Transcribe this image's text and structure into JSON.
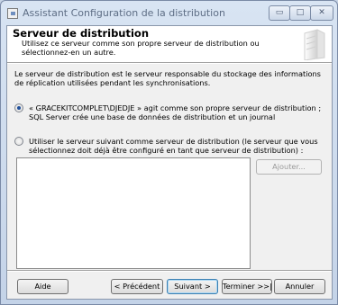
{
  "window": {
    "title": "Assistant Configuration de la distribution",
    "minimize_glyph": "▭",
    "maximize_glyph": "□",
    "close_glyph": "✕"
  },
  "header": {
    "title": "Serveur de distribution",
    "subtitle": "Utilisez ce serveur comme son propre serveur de distribution ou sélectionnez-en un autre."
  },
  "body": {
    "description": "Le serveur de distribution est le serveur responsable du stockage des informations de réplication utilisées pendant les synchronisations.",
    "option_self": {
      "label": "« GRACEKITCOMPLET\\DJEDJE » agit comme son propre serveur de distribution ; SQL Server crée une base de données de distribution et un journal",
      "checked": true
    },
    "option_other": {
      "label": "Utiliser le serveur suivant comme serveur de distribution (le serveur que vous sélectionnez doit déjà être configuré en tant que serveur de distribution) :",
      "checked": false
    },
    "servers_list": [],
    "add_button": "Ajouter..."
  },
  "footer": {
    "help": "Aide",
    "previous": "< Précédent",
    "next": "Suivant >",
    "finish": "Terminer >>|",
    "cancel": "Annuler"
  },
  "icons": {
    "app": "window-app-icon",
    "header_graphic": "server-graphic-icon"
  }
}
